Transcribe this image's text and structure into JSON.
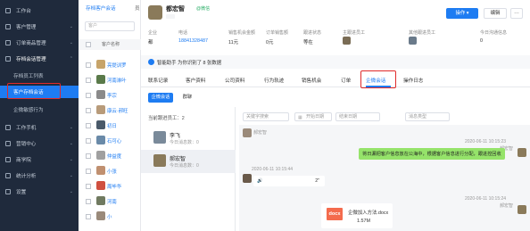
{
  "colors": {
    "sidebar_bg": "#1f2a3c",
    "accent": "#1e7cf2",
    "highlight_box": "#e02a2a",
    "wechat_green": "#2aae67",
    "bubble_green": "#95e36a",
    "docx_red": "#f46b4d"
  },
  "sidebar": {
    "items": [
      {
        "label": "工作台",
        "icon": "home-icon"
      },
      {
        "label": "客户管理",
        "icon": "customer-icon",
        "arrow": "⌄"
      },
      {
        "label": "订单商品管理",
        "icon": "order-icon",
        "arrow": "⌄"
      },
      {
        "label": "存档会话管理",
        "icon": "archive-icon",
        "arrow": "⌃"
      },
      {
        "label": "工作手机",
        "icon": "phone-icon",
        "arrow": "⌄"
      },
      {
        "label": "营销中心",
        "icon": "marketing-icon",
        "arrow": "⌄"
      },
      {
        "label": "商学院",
        "icon": "academy-icon",
        "arrow": "⌄"
      },
      {
        "label": "统计分析",
        "icon": "stats-icon",
        "arrow": "⌄"
      },
      {
        "label": "设置",
        "icon": "settings-icon",
        "arrow": "⌄"
      }
    ],
    "subitems": [
      {
        "label": "存档员工列表"
      },
      {
        "label": "客户存档会话"
      },
      {
        "label": "企微敏感行为"
      }
    ]
  },
  "list_panel": {
    "tab_active": "存档客户会话",
    "tab_other": "员",
    "search_placeholder": "客户",
    "header": "客户名称",
    "rows": [
      {
        "name": "亮提训罗",
        "color": "#c7a46a"
      },
      {
        "name": "河南淋叶",
        "color": "#5a7a4a"
      },
      {
        "name": "李宗",
        "color": "#8a8a8a"
      },
      {
        "name": "康云·郝旺",
        "color": "#b89b7a"
      },
      {
        "name": "初日",
        "color": "#4a5a6a"
      },
      {
        "name": "石可心",
        "color": "#6a8aa8"
      },
      {
        "name": "仲益度",
        "color": "#a0a0a0"
      },
      {
        "name": "小张",
        "color": "#c09070"
      },
      {
        "name": "周毕华",
        "color": "#d05040"
      },
      {
        "name": "河南",
        "color": "#707a60"
      },
      {
        "name": "小",
        "color": "#9a8a7a"
      }
    ]
  },
  "header": {
    "name": "都宏智",
    "wechat": "@微信",
    "primary_button": "操作 ▾",
    "edit_button": "编辑",
    "more_button": "…",
    "info_fields": [
      {
        "label": "企业",
        "value": "都"
      },
      {
        "label": "电话",
        "value": "18841328487"
      },
      {
        "label": "销售机会金额",
        "value": "11元"
      },
      {
        "label": "订单销售额",
        "value": "0元"
      },
      {
        "label": "跟进状态",
        "value": "等在"
      },
      {
        "label": "主跟进员工",
        "value": ""
      },
      {
        "label": "其他跟进员工",
        "value": ""
      },
      {
        "label": "今日沟通信息",
        "value": "0"
      }
    ]
  },
  "assistant": {
    "text": "智能助手 为你识别了 8 张数据"
  },
  "tabs": [
    "联系记录",
    "客户资料",
    "公司资料",
    "行为轨迹",
    "销售机会",
    "订单",
    "企微会话",
    "操作日志"
  ],
  "active_tab": "企微会话",
  "subtabs": {
    "active": "企微会话",
    "other": "群聊"
  },
  "conversation_list": {
    "title": "当前跟进员工：2",
    "rows": [
      {
        "name": "李飞",
        "sub": "今日消息数：0"
      },
      {
        "name": "郝宏智",
        "sub": "今日消息数：0"
      }
    ]
  },
  "filters": {
    "keyword": "关键字搜索",
    "date_start": "开始日期",
    "date_end": "结束日期",
    "msg_type": "消息类型"
  },
  "chat": {
    "top_sender": "郝宏智",
    "msg1_time": "2020-06-11 10:15:23",
    "msg1_sender": "郝宏智",
    "msg1_text": "将日漏把客户信息放在公海中，根据客户信息进行分配，跟进控回收",
    "msg2_time": "2020-06-11 10:15:44",
    "msg2_text": "2\"",
    "msg3_time": "2020-06-11 10:15:24",
    "msg3_sender": "郝宏智",
    "file_type": "docx",
    "file_name": "企微加入方法.docx",
    "file_size": "1.57M"
  }
}
